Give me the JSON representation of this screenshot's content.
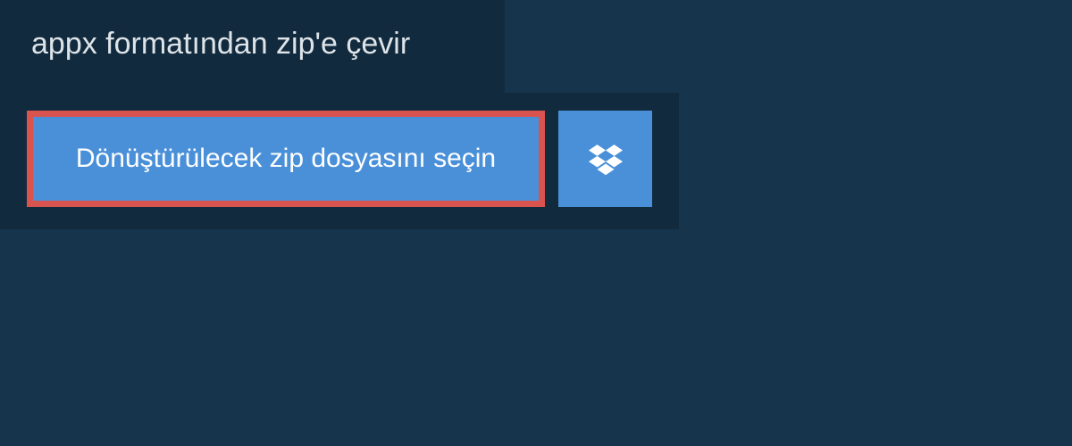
{
  "title": "appx formatından zip'e çevir",
  "buttons": {
    "select_file_label": "Dönüştürülecek zip dosyasını seçin"
  },
  "colors": {
    "background": "#16344c",
    "panel": "#122a3d",
    "button_blue": "#4a90d9",
    "highlight_border": "#d9534f",
    "text_light": "#dde4e9"
  }
}
